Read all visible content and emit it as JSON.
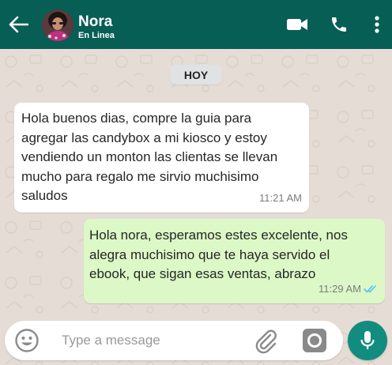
{
  "header": {
    "contact_name": "Nora",
    "status": "En Linea",
    "color": "#075e54"
  },
  "chat": {
    "day_label": "HOY",
    "background": "#e5ddd5",
    "messages": [
      {
        "direction": "incoming",
        "text": "Hola buenos dias, compre la guia para\nagregar las candybox a mi kiosco y estoy\nvendiendo un monton las clientas se llevan\nmucho para regalo me sirvio muchisimo\nsaludos",
        "time": "11:21 AM"
      },
      {
        "direction": "outgoing",
        "text": "Hola nora, esperamos estes excelente, nos\nalegra muchisimo que te haya servido el\nebook, que sigan esas ventas, abrazo",
        "time": "11:29 AM",
        "read_receipt": "double-check-icon",
        "receipt_color": "#4fc3f7"
      }
    ]
  },
  "composer": {
    "placeholder": "Type a message",
    "value": "",
    "icons": [
      "smiley-icon",
      "paperclip-icon",
      "camera-icon",
      "microphone-icon"
    ],
    "mic_color": "#128c7e"
  }
}
